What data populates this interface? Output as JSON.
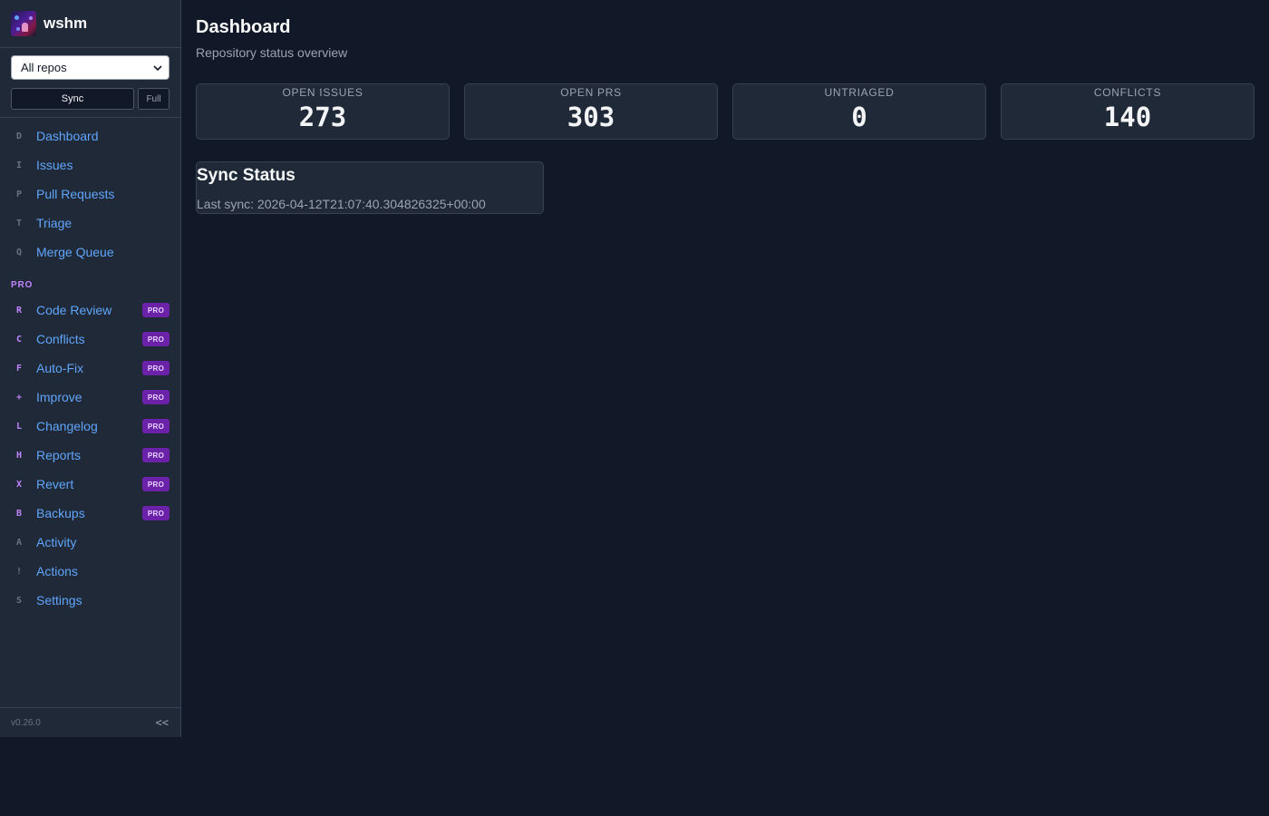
{
  "app": {
    "name": "wshm",
    "logo_icon": "wizard-avatar-icon",
    "version": "v0.26.0",
    "collapse_label": "<<"
  },
  "sidebar": {
    "repo_select": {
      "value": "All repos"
    },
    "sync_label": "Sync",
    "full_label": "Full",
    "nav": [
      {
        "key": "D",
        "label": "Dashboard"
      },
      {
        "key": "I",
        "label": "Issues"
      },
      {
        "key": "P",
        "label": "Pull Requests"
      },
      {
        "key": "T",
        "label": "Triage"
      },
      {
        "key": "Q",
        "label": "Merge Queue"
      }
    ],
    "pro_section_label": "PRO",
    "pro_badge": "PRO",
    "pro_nav": [
      {
        "key": "R",
        "label": "Code Review"
      },
      {
        "key": "C",
        "label": "Conflicts"
      },
      {
        "key": "F",
        "label": "Auto-Fix"
      },
      {
        "key": "+",
        "label": "Improve"
      },
      {
        "key": "L",
        "label": "Changelog"
      },
      {
        "key": "H",
        "label": "Reports"
      },
      {
        "key": "X",
        "label": "Revert"
      },
      {
        "key": "B",
        "label": "Backups"
      }
    ],
    "extra_nav": [
      {
        "key": "A",
        "label": "Activity"
      },
      {
        "key": "!",
        "label": "Actions"
      },
      {
        "key": "S",
        "label": "Settings"
      }
    ]
  },
  "main": {
    "title": "Dashboard",
    "subtitle": "Repository status overview",
    "stats": [
      {
        "label": "OPEN ISSUES",
        "value": "273"
      },
      {
        "label": "OPEN PRS",
        "value": "303"
      },
      {
        "label": "UNTRIAGED",
        "value": "0"
      },
      {
        "label": "CONFLICTS",
        "value": "140"
      }
    ],
    "sync_status": {
      "title": "Sync Status",
      "last_sync": "Last sync: 2026-04-12T21:07:40.304826325+00:00"
    }
  },
  "colors": {
    "background": "#111827",
    "sidebar": "#1f2937",
    "link": "#60a5fa",
    "pro_accent": "#c084fc",
    "pro_badge_bg": "#6b21a8"
  }
}
